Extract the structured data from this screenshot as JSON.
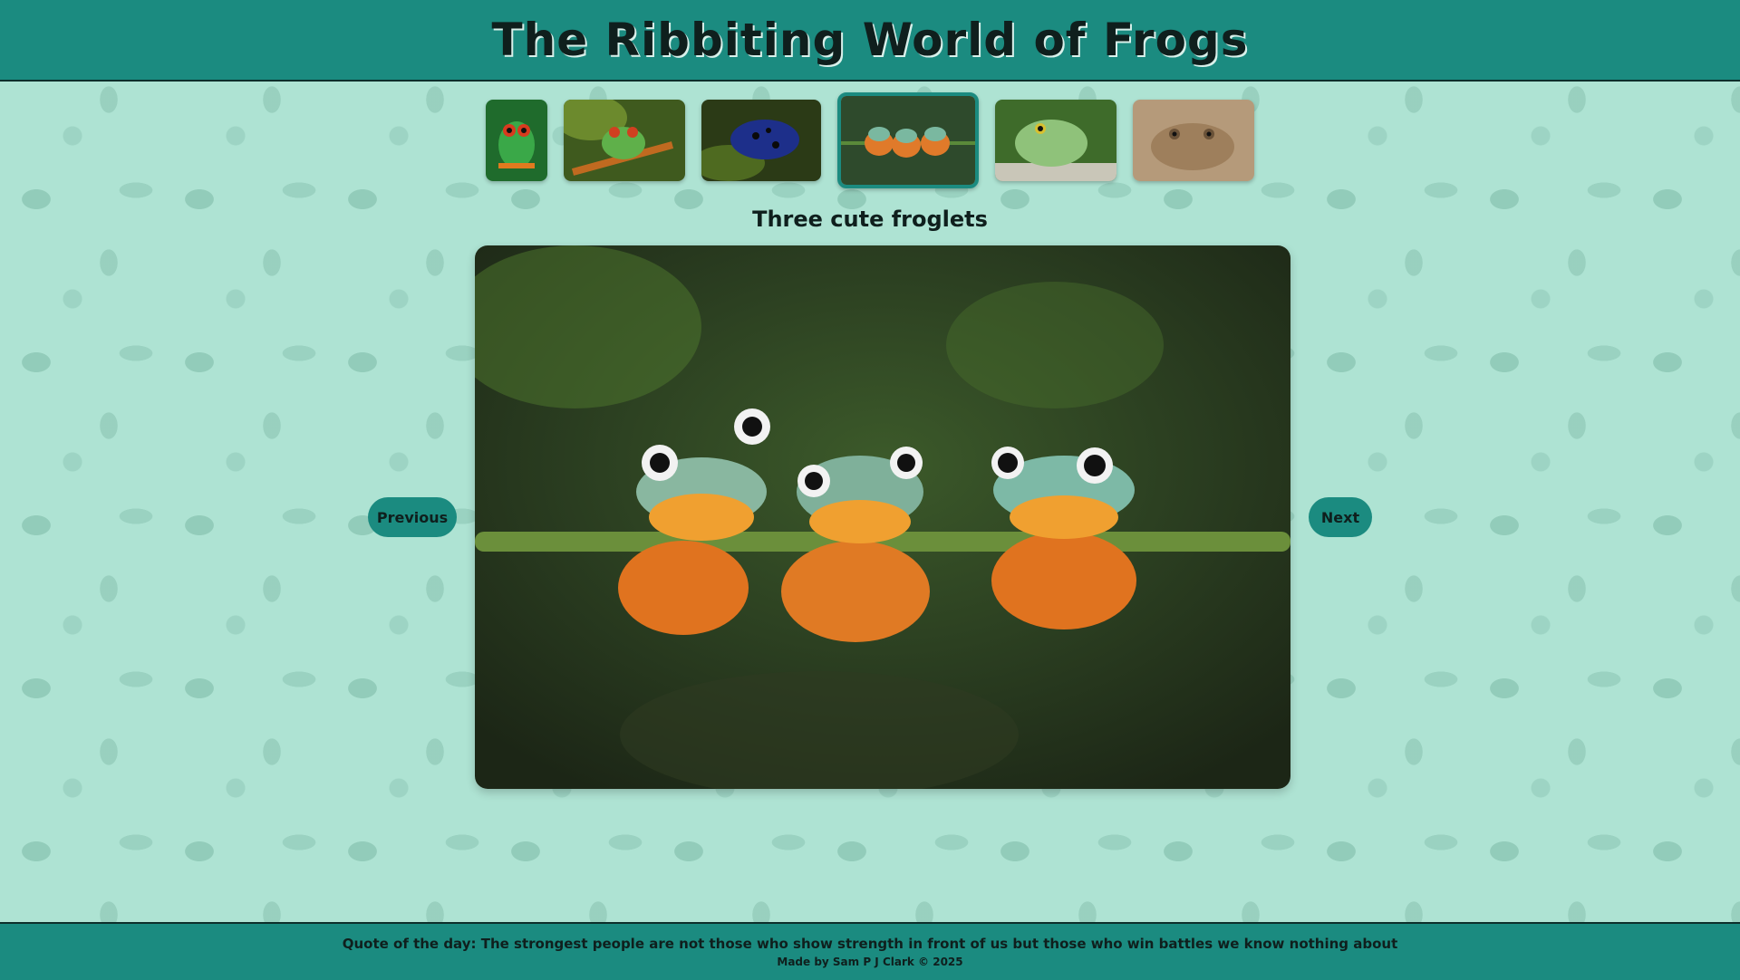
{
  "header": {
    "title": "The Ribbiting World of Frogs"
  },
  "gallery": {
    "thumbnails": [
      {
        "name": "red-eyed-tree-frog",
        "active": false
      },
      {
        "name": "smiling-frog-on-branch",
        "active": false
      },
      {
        "name": "blue-poison-dart-frog",
        "active": false
      },
      {
        "name": "three-froglets",
        "active": true
      },
      {
        "name": "green-tree-frog",
        "active": false
      },
      {
        "name": "toad",
        "active": false
      }
    ],
    "caption": "Three cute froglets",
    "prev_label": "Previous",
    "next_label": "Next"
  },
  "footer": {
    "quote": "Quote of the day: The strongest people are not those who show strength in front of us but those who win battles we know nothing about",
    "credit": "Made by Sam P J Clark © 2025"
  },
  "colors": {
    "accent": "#1b8b80",
    "background": "#aee3d3",
    "text": "#0f1f1d"
  }
}
